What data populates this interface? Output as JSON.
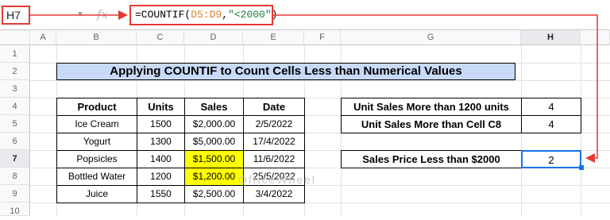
{
  "formula_bar": {
    "name_box": "H7",
    "fx_label": "fx",
    "formula_prefix": "=COUNTIF(",
    "formula_range": "D5:D9",
    "formula_sep": ",",
    "formula_criteria": "\"<2000\"",
    "formula_suffix": ")"
  },
  "columns": [
    "A",
    "B",
    "C",
    "D",
    "E",
    "F",
    "G",
    "H"
  ],
  "rows": [
    "1",
    "2",
    "3",
    "4",
    "5",
    "6",
    "7",
    "8",
    "9",
    "10"
  ],
  "selected_cell": {
    "column": "H",
    "row": "7"
  },
  "title": "Applying COUNTIF to Count Cells Less than Numerical Values",
  "table": {
    "headers": [
      "Product",
      "Units",
      "Sales",
      "Date"
    ],
    "rows": [
      [
        "Ice Cream",
        "1500",
        "$2,000.00",
        "2/5/2022"
      ],
      [
        "Yogurt",
        "1300",
        "$5,000.00",
        "17/4/2022"
      ],
      [
        "Popsicles",
        "1400",
        "$1,500.00",
        "11/6/2022"
      ],
      [
        "Bottled Water",
        "1200",
        "$1,200.00",
        "25/5/2022"
      ],
      [
        "Juice",
        "1550",
        "$2,500.00",
        "3/4/2022"
      ]
    ],
    "highlight_color": "#ffff00"
  },
  "results": [
    {
      "label": "Unit Sales More than 1200 units",
      "value": "4"
    },
    {
      "label": "Unit Sales More than Cell C8",
      "value": "4"
    },
    {
      "label": "Sales Price Less than $2000",
      "value": "2"
    }
  ],
  "watermark": "OfficeWheel",
  "accent_color": "#e53935"
}
